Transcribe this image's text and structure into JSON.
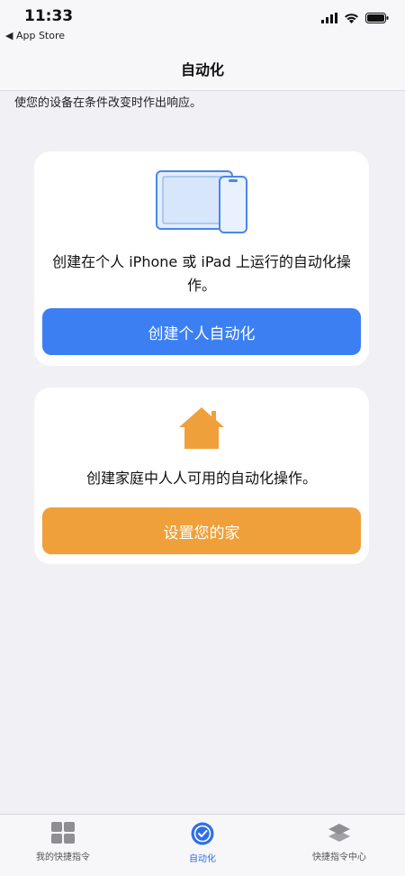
{
  "status_bar": {
    "time": "11:33",
    "back_label": "◀ App Store"
  },
  "nav": {
    "title": "自动化"
  },
  "subtitle": "使您的设备在条件改变时作出响应。",
  "personal_card": {
    "description": "创建在个人 iPhone 或 iPad 上运行的自动化操作。",
    "button_label": "创建个人自动化",
    "icon": "ipad-iphone-icon"
  },
  "home_card": {
    "description": "创建家庭中人人可用的自动化操作。",
    "button_label": "设置您的家",
    "icon": "house-icon"
  },
  "tabs": [
    {
      "label": "我的快捷指令",
      "icon": "grid-icon",
      "active": false
    },
    {
      "label": "自动化",
      "icon": "clock-check-icon",
      "active": true
    },
    {
      "label": "快捷指令中心",
      "icon": "layers-icon",
      "active": false
    }
  ],
  "colors": {
    "accent": "#3b7ff2",
    "home": "#f0a03a",
    "background": "#f0f0f5"
  }
}
